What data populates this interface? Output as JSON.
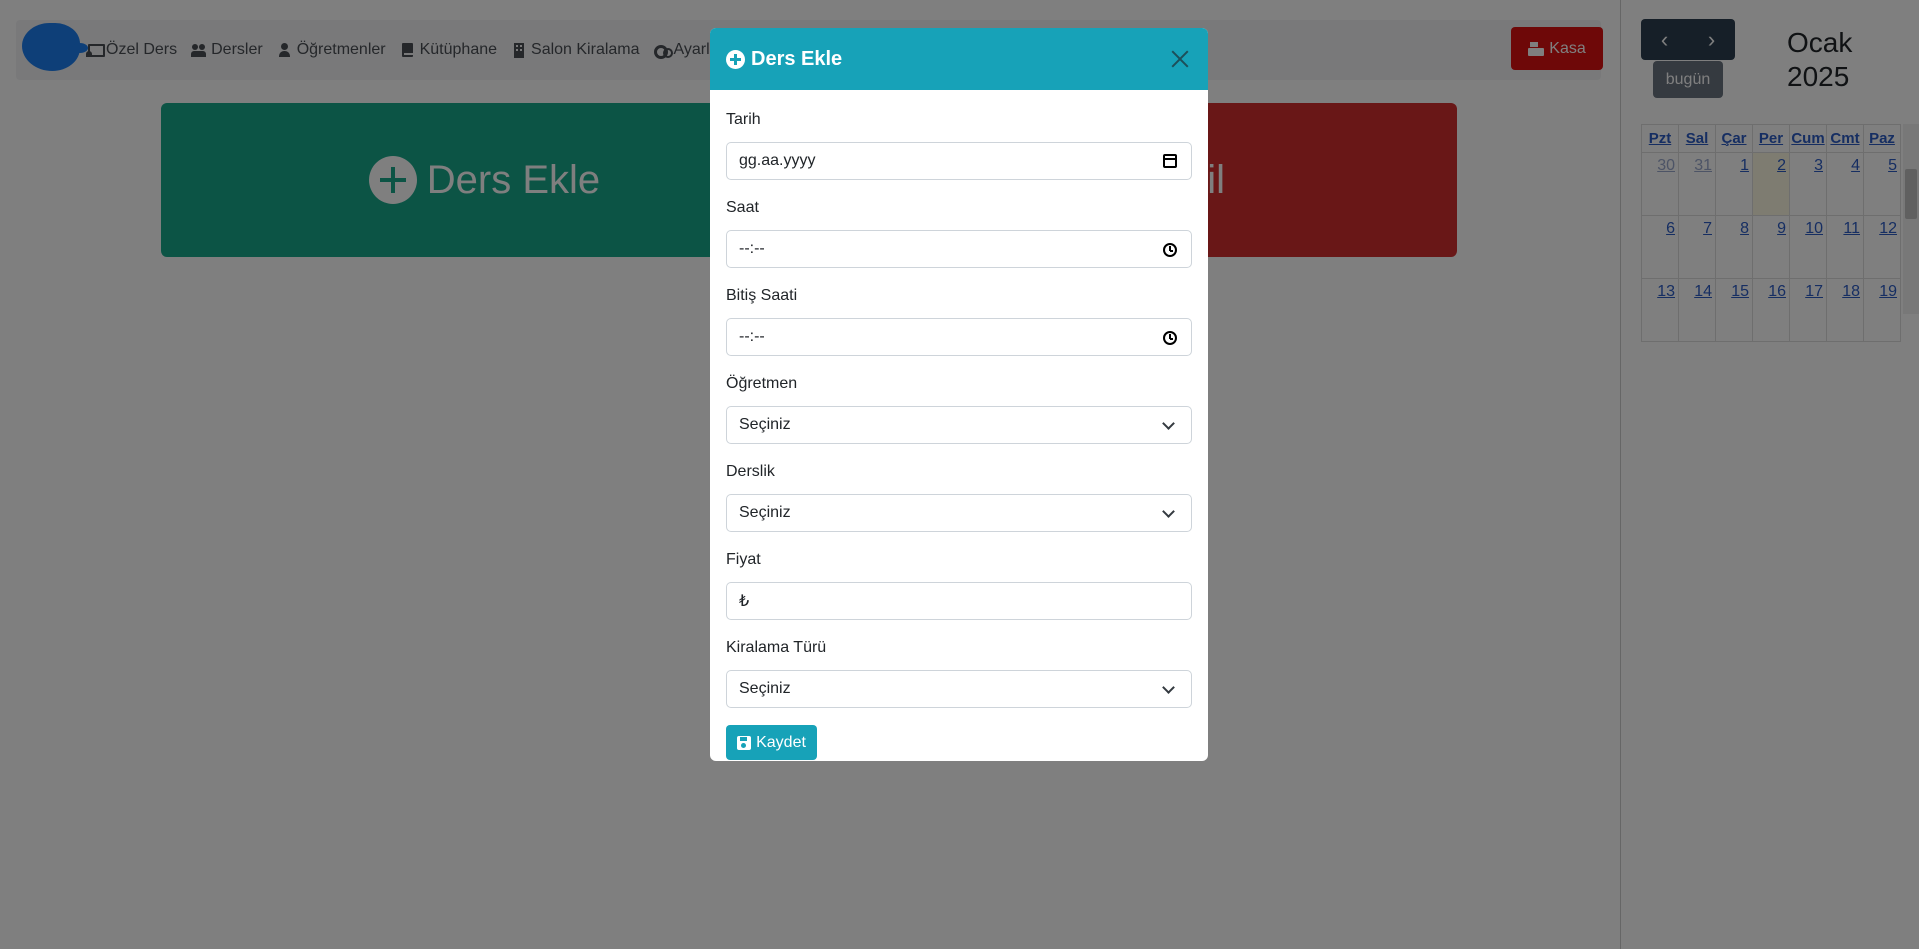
{
  "navbar": {
    "items": [
      {
        "label": "Özel Ders",
        "icon": "chalkboard-teacher-icon"
      },
      {
        "label": "Dersler",
        "icon": "users-icon"
      },
      {
        "label": "Öğretmenler",
        "icon": "user-tie-icon"
      },
      {
        "label": "Kütüphane",
        "icon": "book-icon"
      },
      {
        "label": "Salon Kiralama",
        "icon": "building-icon"
      },
      {
        "label": "Ayarl",
        "icon": "gears-icon"
      }
    ],
    "kasa_label": "Kasa"
  },
  "tiles": {
    "add_lesson_label": "Ders Ekle",
    "second_tile_partial": "il"
  },
  "calendar": {
    "today_label": "bugün",
    "month": "Ocak",
    "year": "2025",
    "weekdays": [
      "Pzt",
      "Sal",
      "Çar",
      "Per",
      "Cum",
      "Cmt",
      "Paz"
    ],
    "weeks": [
      [
        "30",
        "31",
        "1",
        "2",
        "3",
        "4",
        "5"
      ],
      [
        "6",
        "7",
        "8",
        "9",
        "10",
        "11",
        "12"
      ],
      [
        "13",
        "14",
        "15",
        "16",
        "17",
        "18",
        "19"
      ]
    ]
  },
  "modal": {
    "title": "Ders Ekle",
    "fields": {
      "tarih": {
        "label": "Tarih",
        "placeholder": "gg.aa.yyyy"
      },
      "saat": {
        "label": "Saat",
        "placeholder": "--:--"
      },
      "bitis": {
        "label": "Bitiş Saati",
        "placeholder": "--:--"
      },
      "ogretmen": {
        "label": "Öğretmen",
        "value": "Seçiniz"
      },
      "derslik": {
        "label": "Derslik",
        "value": "Seçiniz"
      },
      "fiyat": {
        "label": "Fiyat",
        "placeholder": "₺"
      },
      "kiralama": {
        "label": "Kiralama Türü",
        "value": "Seçiniz"
      }
    },
    "save_label": "Kaydet"
  },
  "colors": {
    "modal_header": "#17a2b8",
    "kasa_button": "#dc1010",
    "tile_green": "#19a88b",
    "tile_red": "#d32f2f"
  }
}
